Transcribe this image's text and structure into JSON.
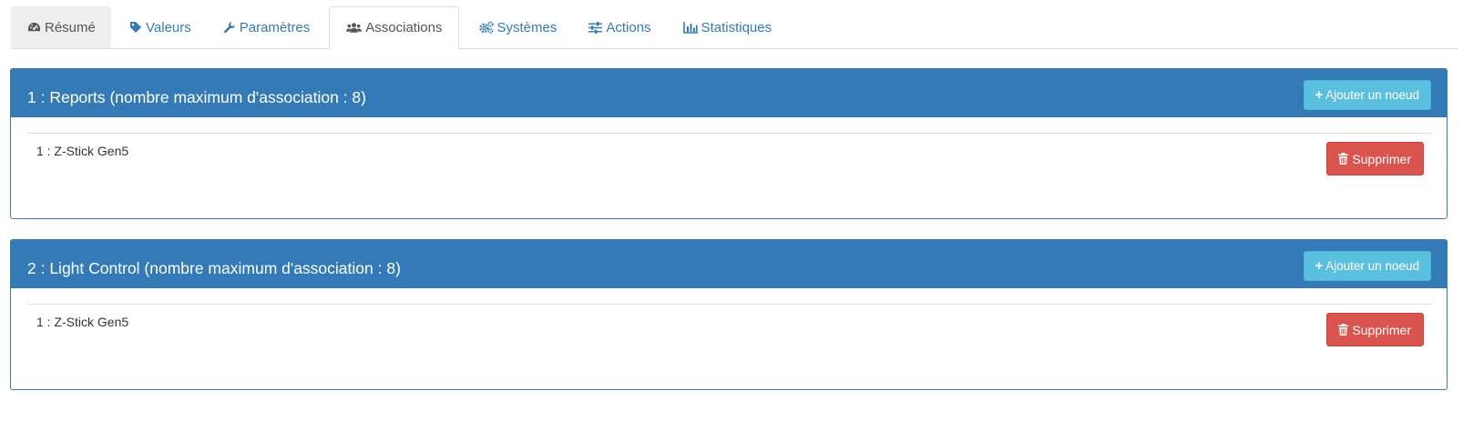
{
  "tabs": [
    {
      "label": "Résumé",
      "icon": "dashboard-icon"
    },
    {
      "label": "Valeurs",
      "icon": "tag-icon"
    },
    {
      "label": "Paramètres",
      "icon": "wrench-icon"
    },
    {
      "label": "Associations",
      "icon": "users-icon",
      "active": true
    },
    {
      "label": "Systèmes",
      "icon": "cogs-icon"
    },
    {
      "label": "Actions",
      "icon": "sliders-icon"
    },
    {
      "label": "Statistiques",
      "icon": "bar-chart-icon"
    }
  ],
  "groups": [
    {
      "title": "1 : Reports (nombre maximum d'association : 8)",
      "add_label": "Ajouter un noeud",
      "nodes": [
        {
          "label": "1 : Z-Stick Gen5",
          "delete_label": "Supprimer"
        }
      ]
    },
    {
      "title": "2 : Light Control (nombre maximum d'association : 8)",
      "add_label": "Ajouter un noeud",
      "nodes": [
        {
          "label": "1 : Z-Stick Gen5",
          "delete_label": "Supprimer"
        }
      ]
    }
  ],
  "colors": {
    "primary": "#337ab7",
    "info": "#5bc0de",
    "danger": "#d9534f",
    "tab_link": "#337ab7"
  }
}
